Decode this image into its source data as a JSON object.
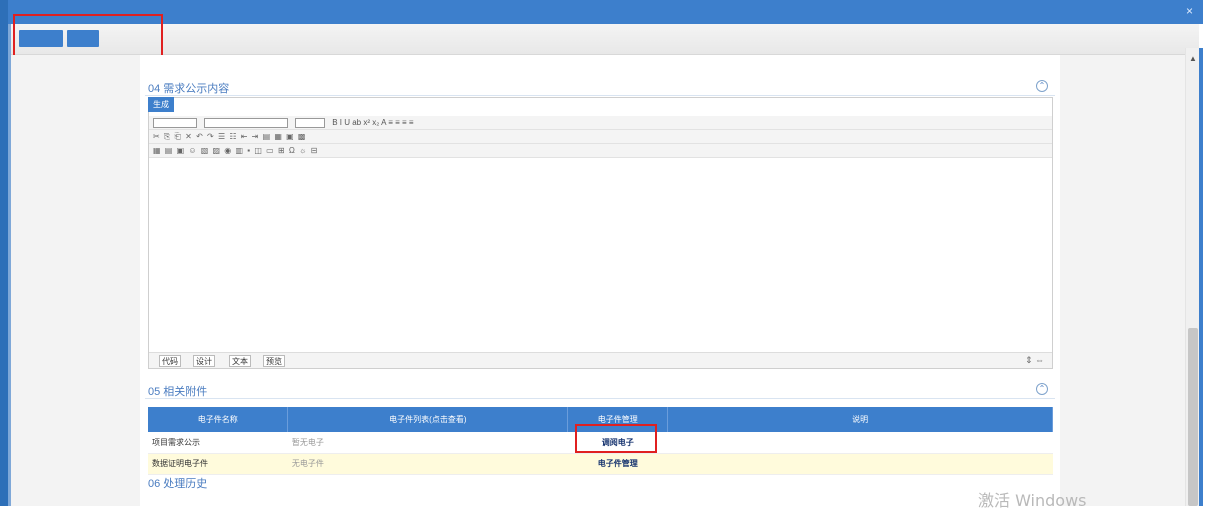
{
  "window": {
    "title": "",
    "close": "×"
  },
  "toolbar": {
    "btn1": "",
    "btn2": ""
  },
  "sections": {
    "s04": {
      "title": "04 需求公示内容",
      "collapse": "⌃"
    },
    "s05": {
      "title": "05 相关附件",
      "collapse": "⌃"
    },
    "s06": {
      "title": "06 处理历史"
    }
  },
  "editor": {
    "generate": "生成",
    "selects": [
      "",
      "",
      ""
    ],
    "icon_rows": [
      "B I U ab x² x₂ A ≡ ≡ ≡ ≡",
      "✂ ⎘ ⎗ ✕ ↶ ↷ ☰ ☷ ⇤ ⇥ ▤ ▦ ▣ ▩",
      "▦ ▤ ▣ ☺ ▧ ▨ ◉ ▥ ▪ ◫ ▭ ⊞ Ω ☼ ⊟"
    ],
    "modes": [
      "代码",
      "设计",
      "文本",
      "预览"
    ],
    "resize": "⇕ ⇔"
  },
  "attachments": {
    "headers": [
      "电子件名称",
      "电子件列表(点击查看)",
      "电子件管理",
      "说明"
    ],
    "rows": [
      {
        "name": "项目需求公示",
        "list": "暂无电子",
        "manage": "调阅电子",
        "note": ""
      },
      {
        "name": "数据证明电子件",
        "list": "无电子件",
        "manage": "电子件管理",
        "note": ""
      }
    ]
  },
  "watermark": "激活 Windows"
}
